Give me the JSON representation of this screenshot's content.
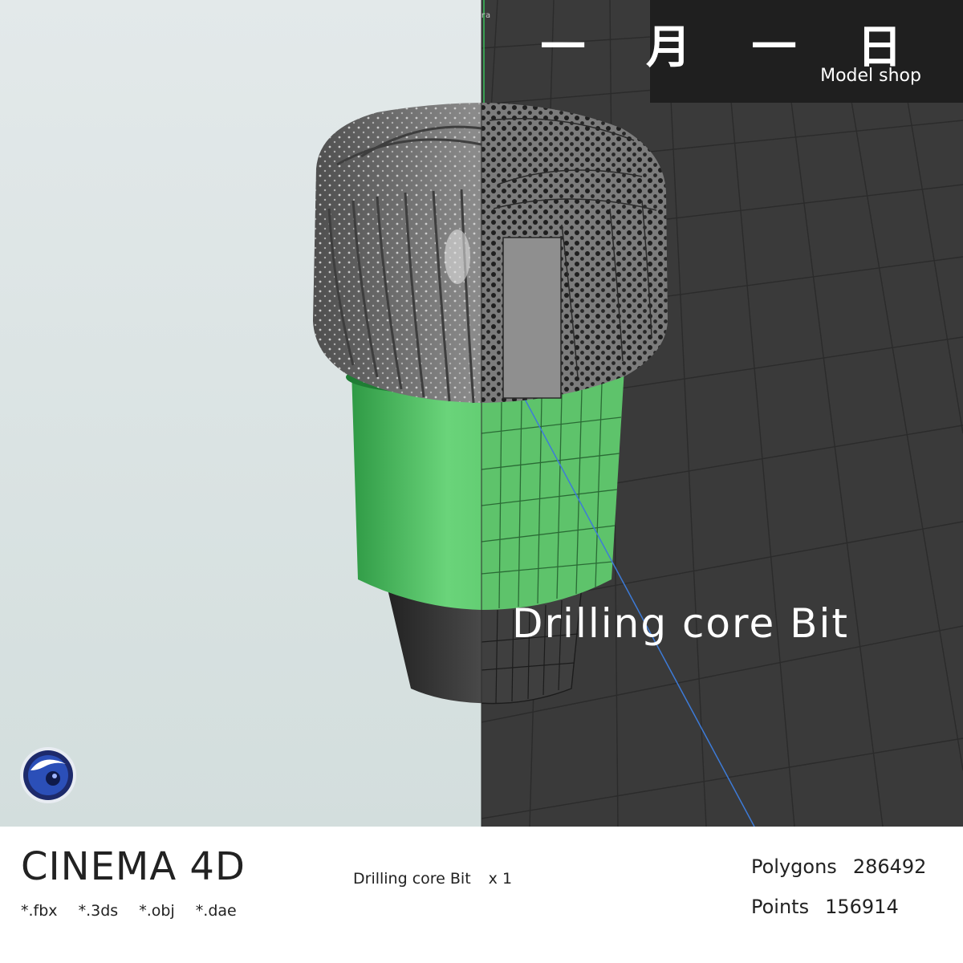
{
  "brand": {
    "title": "一 月 一 日",
    "subtitle": "Model shop"
  },
  "overlay_title": "Drilling core Bit",
  "camera_label": "ra",
  "software": {
    "name": "CINEMA 4D",
    "logo_icon": "cinema4d-logo-icon"
  },
  "formats": [
    "*.fbx",
    "*.3ds",
    "*.obj",
    "*.dae"
  ],
  "product": {
    "name": "Drilling core Bit",
    "quantity": "x 1"
  },
  "stats": {
    "polygons_label": "Polygons",
    "polygons_value": "286492",
    "points_label": "Points",
    "points_value": "156914"
  },
  "colors": {
    "render_bg": "#d8e2e2",
    "viewport_bg": "#3a3a3a",
    "green_body": "#5cc96c",
    "crown_grey": "#7e7e7e",
    "shank_dark": "#3c3c3c",
    "brand_box": "#1f1f1f",
    "footer_bg": "#ffffff"
  }
}
